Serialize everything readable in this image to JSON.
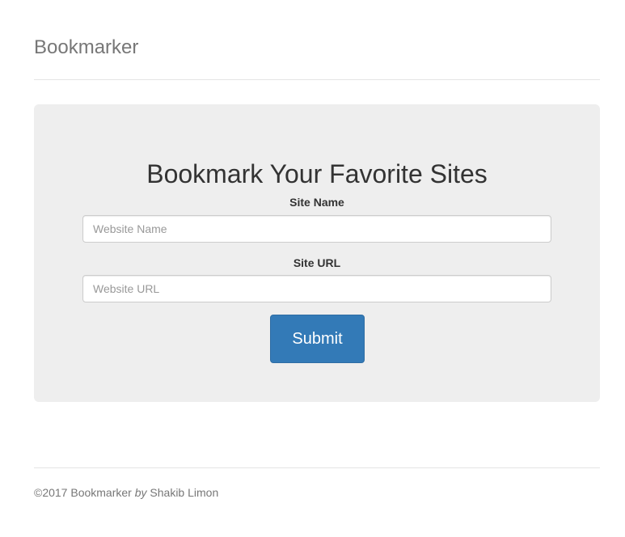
{
  "header": {
    "brand": "Bookmarker"
  },
  "form": {
    "title": "Bookmark Your Favorite Sites",
    "site_name_label": "Site Name",
    "site_name_placeholder": "Website Name",
    "site_name_value": "",
    "site_url_label": "Site URL",
    "site_url_placeholder": "Website URL",
    "site_url_value": "",
    "submit_label": "Submit"
  },
  "footer": {
    "copyright": "©2017 Bookmarker",
    "by": "by",
    "author": "Shakib Limon"
  },
  "colors": {
    "primary": "#337ab7",
    "jumbotron_bg": "#eeeeee",
    "muted_text": "#777777"
  }
}
